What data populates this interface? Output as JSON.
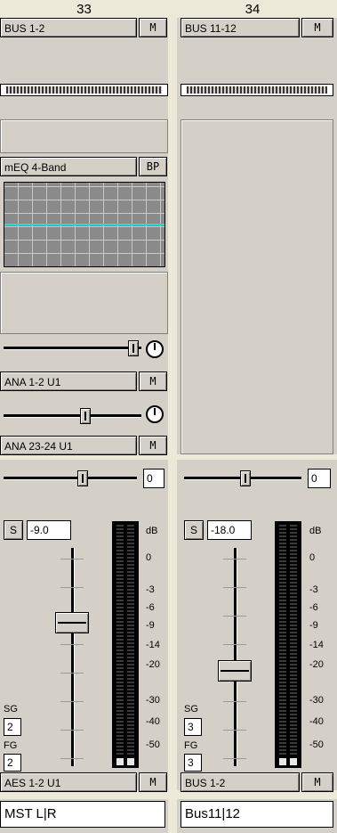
{
  "channels": [
    {
      "number": "33",
      "bus": "BUS 1-2",
      "mute": "M",
      "plugin": {
        "name": "mEQ 4-Band",
        "bypass": "BP"
      },
      "sends": [
        {
          "label": "ANA 1-2 U1",
          "mute": "M",
          "level": 0.95
        },
        {
          "label": "ANA 23-24 U1",
          "mute": "M",
          "level": 0.6
        }
      ],
      "pan_value": "0",
      "pan_position": 0.5,
      "solo": "S",
      "gain": "-9.0",
      "fader_position": 0.34,
      "sg_label": "SG",
      "sg_value": "2",
      "fg_label": "FG",
      "fg_value": "2",
      "output": "AES 1-2 U1",
      "output_mute": "M",
      "name": "MST L|R"
    },
    {
      "number": "34",
      "bus": "BUS 11-12",
      "mute": "M",
      "pan_value": "0",
      "pan_position": 0.5,
      "solo": "S",
      "gain": "-18.0",
      "fader_position": 0.56,
      "sg_label": "SG",
      "sg_value": "3",
      "fg_label": "FG",
      "fg_value": "3",
      "output": "BUS 1-2",
      "output_mute": "M",
      "name": "Bus11|12"
    }
  ],
  "db_scale": [
    "dB",
    "0",
    "-3",
    "-6",
    "-9",
    "-14",
    "-20",
    "-30",
    "-40",
    "-50"
  ]
}
